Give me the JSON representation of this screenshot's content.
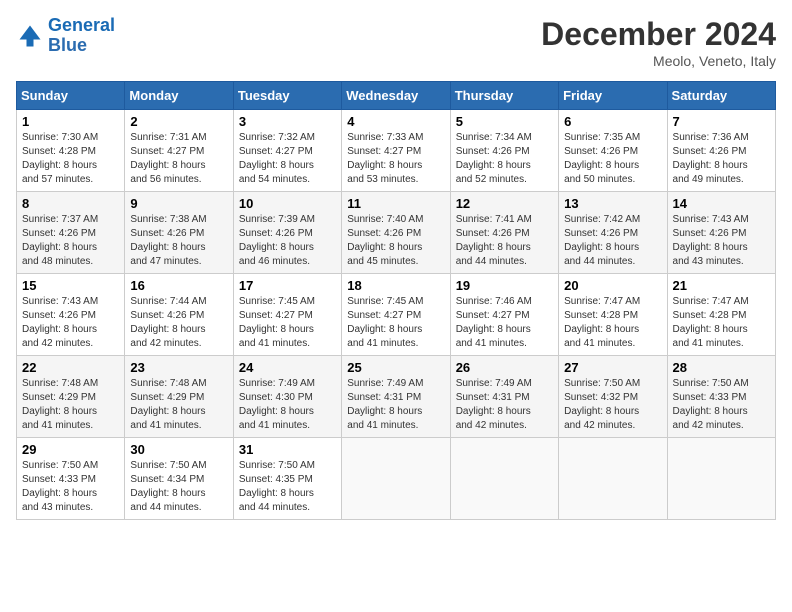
{
  "header": {
    "logo_line1": "General",
    "logo_line2": "Blue",
    "month": "December 2024",
    "location": "Meolo, Veneto, Italy"
  },
  "weekdays": [
    "Sunday",
    "Monday",
    "Tuesday",
    "Wednesday",
    "Thursday",
    "Friday",
    "Saturday"
  ],
  "weeks": [
    [
      {
        "day": "1",
        "info": "Sunrise: 7:30 AM\nSunset: 4:28 PM\nDaylight: 8 hours\nand 57 minutes."
      },
      {
        "day": "2",
        "info": "Sunrise: 7:31 AM\nSunset: 4:27 PM\nDaylight: 8 hours\nand 56 minutes."
      },
      {
        "day": "3",
        "info": "Sunrise: 7:32 AM\nSunset: 4:27 PM\nDaylight: 8 hours\nand 54 minutes."
      },
      {
        "day": "4",
        "info": "Sunrise: 7:33 AM\nSunset: 4:27 PM\nDaylight: 8 hours\nand 53 minutes."
      },
      {
        "day": "5",
        "info": "Sunrise: 7:34 AM\nSunset: 4:26 PM\nDaylight: 8 hours\nand 52 minutes."
      },
      {
        "day": "6",
        "info": "Sunrise: 7:35 AM\nSunset: 4:26 PM\nDaylight: 8 hours\nand 50 minutes."
      },
      {
        "day": "7",
        "info": "Sunrise: 7:36 AM\nSunset: 4:26 PM\nDaylight: 8 hours\nand 49 minutes."
      }
    ],
    [
      {
        "day": "8",
        "info": "Sunrise: 7:37 AM\nSunset: 4:26 PM\nDaylight: 8 hours\nand 48 minutes."
      },
      {
        "day": "9",
        "info": "Sunrise: 7:38 AM\nSunset: 4:26 PM\nDaylight: 8 hours\nand 47 minutes."
      },
      {
        "day": "10",
        "info": "Sunrise: 7:39 AM\nSunset: 4:26 PM\nDaylight: 8 hours\nand 46 minutes."
      },
      {
        "day": "11",
        "info": "Sunrise: 7:40 AM\nSunset: 4:26 PM\nDaylight: 8 hours\nand 45 minutes."
      },
      {
        "day": "12",
        "info": "Sunrise: 7:41 AM\nSunset: 4:26 PM\nDaylight: 8 hours\nand 44 minutes."
      },
      {
        "day": "13",
        "info": "Sunrise: 7:42 AM\nSunset: 4:26 PM\nDaylight: 8 hours\nand 44 minutes."
      },
      {
        "day": "14",
        "info": "Sunrise: 7:43 AM\nSunset: 4:26 PM\nDaylight: 8 hours\nand 43 minutes."
      }
    ],
    [
      {
        "day": "15",
        "info": "Sunrise: 7:43 AM\nSunset: 4:26 PM\nDaylight: 8 hours\nand 42 minutes."
      },
      {
        "day": "16",
        "info": "Sunrise: 7:44 AM\nSunset: 4:26 PM\nDaylight: 8 hours\nand 42 minutes."
      },
      {
        "day": "17",
        "info": "Sunrise: 7:45 AM\nSunset: 4:27 PM\nDaylight: 8 hours\nand 41 minutes."
      },
      {
        "day": "18",
        "info": "Sunrise: 7:45 AM\nSunset: 4:27 PM\nDaylight: 8 hours\nand 41 minutes."
      },
      {
        "day": "19",
        "info": "Sunrise: 7:46 AM\nSunset: 4:27 PM\nDaylight: 8 hours\nand 41 minutes."
      },
      {
        "day": "20",
        "info": "Sunrise: 7:47 AM\nSunset: 4:28 PM\nDaylight: 8 hours\nand 41 minutes."
      },
      {
        "day": "21",
        "info": "Sunrise: 7:47 AM\nSunset: 4:28 PM\nDaylight: 8 hours\nand 41 minutes."
      }
    ],
    [
      {
        "day": "22",
        "info": "Sunrise: 7:48 AM\nSunset: 4:29 PM\nDaylight: 8 hours\nand 41 minutes."
      },
      {
        "day": "23",
        "info": "Sunrise: 7:48 AM\nSunset: 4:29 PM\nDaylight: 8 hours\nand 41 minutes."
      },
      {
        "day": "24",
        "info": "Sunrise: 7:49 AM\nSunset: 4:30 PM\nDaylight: 8 hours\nand 41 minutes."
      },
      {
        "day": "25",
        "info": "Sunrise: 7:49 AM\nSunset: 4:31 PM\nDaylight: 8 hours\nand 41 minutes."
      },
      {
        "day": "26",
        "info": "Sunrise: 7:49 AM\nSunset: 4:31 PM\nDaylight: 8 hours\nand 42 minutes."
      },
      {
        "day": "27",
        "info": "Sunrise: 7:50 AM\nSunset: 4:32 PM\nDaylight: 8 hours\nand 42 minutes."
      },
      {
        "day": "28",
        "info": "Sunrise: 7:50 AM\nSunset: 4:33 PM\nDaylight: 8 hours\nand 42 minutes."
      }
    ],
    [
      {
        "day": "29",
        "info": "Sunrise: 7:50 AM\nSunset: 4:33 PM\nDaylight: 8 hours\nand 43 minutes."
      },
      {
        "day": "30",
        "info": "Sunrise: 7:50 AM\nSunset: 4:34 PM\nDaylight: 8 hours\nand 44 minutes."
      },
      {
        "day": "31",
        "info": "Sunrise: 7:50 AM\nSunset: 4:35 PM\nDaylight: 8 hours\nand 44 minutes."
      },
      null,
      null,
      null,
      null
    ]
  ]
}
